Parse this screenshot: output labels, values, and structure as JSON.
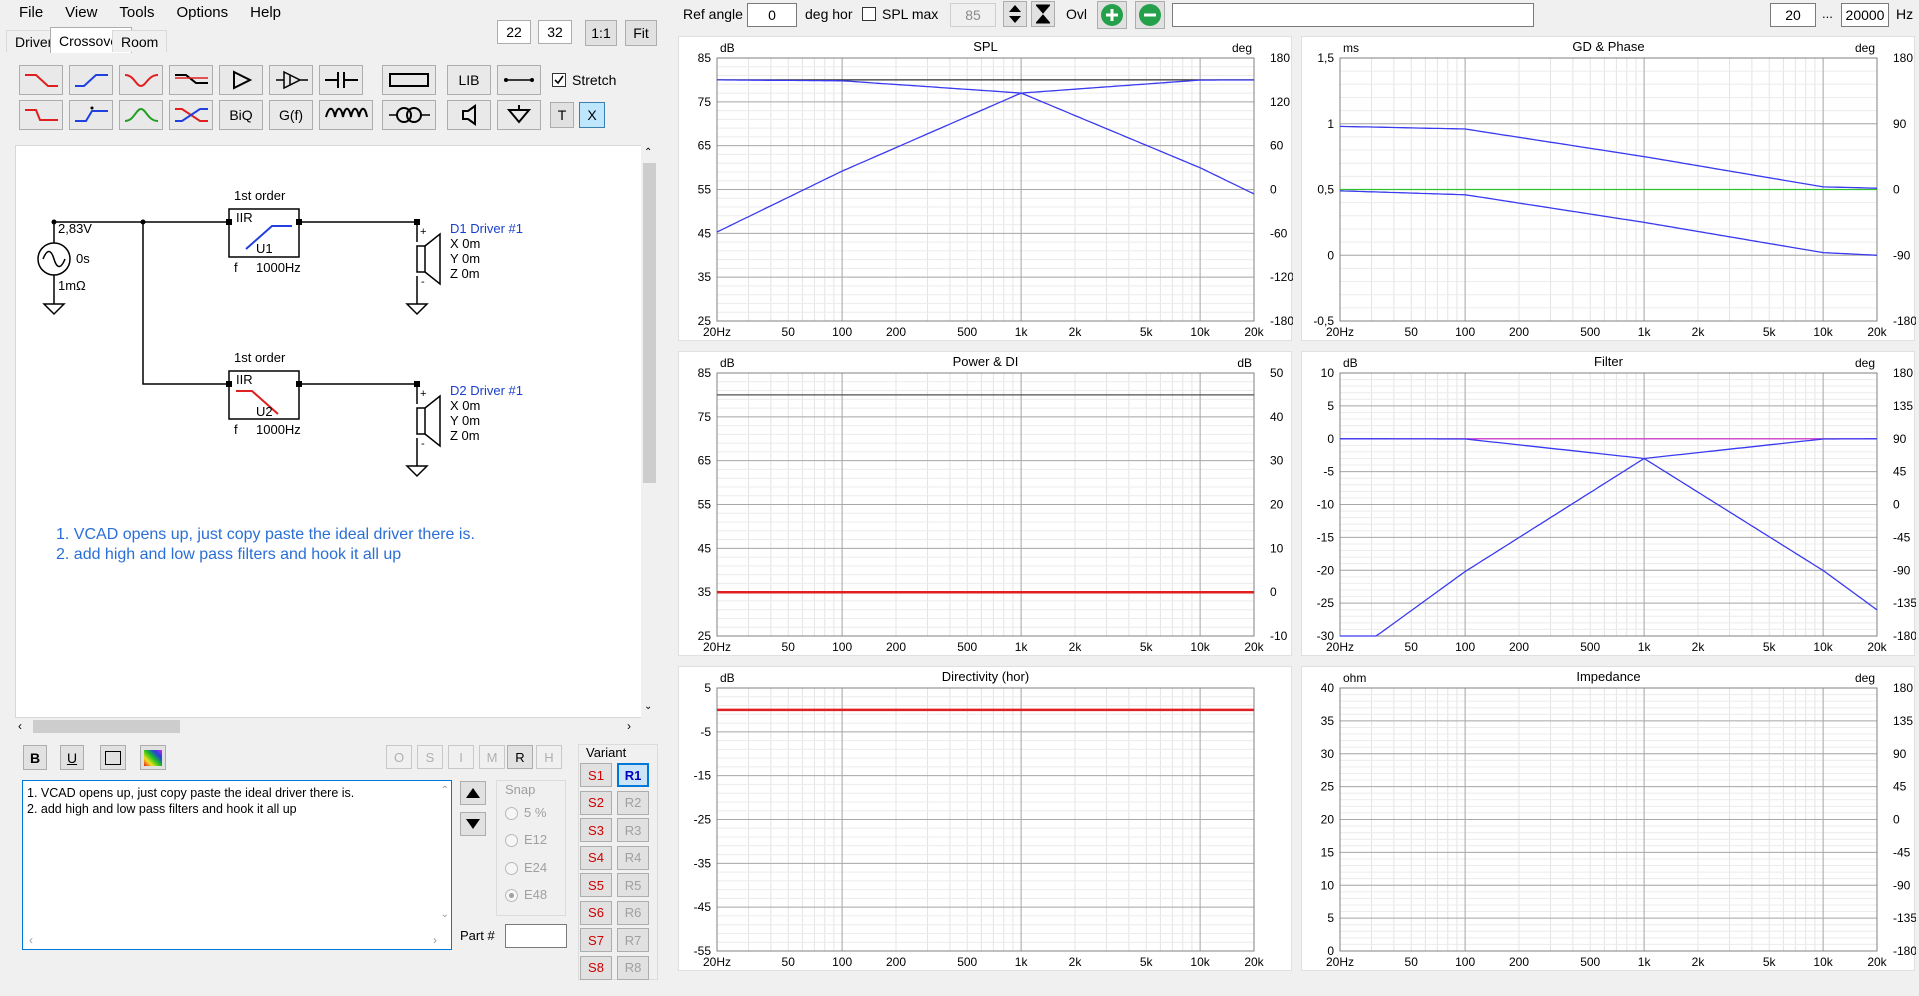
{
  "menu": [
    "File",
    "View",
    "Tools",
    "Options",
    "Help"
  ],
  "tabs": [
    "Drivers",
    "Crossover",
    "Room"
  ],
  "zoom": {
    "a": "22",
    "b": "32",
    "one": "1:1",
    "fit": "Fit"
  },
  "toolbar": {
    "lib": "LIB",
    "biq": "BiQ",
    "gf": "G(f)",
    "t": "T",
    "x": "X",
    "stretch": "Stretch"
  },
  "schematic": {
    "source_v": "2,83V",
    "source_t": "0s",
    "source_r": "1mΩ",
    "f1_title": "1st order",
    "f1_type": "IIR",
    "f1_name": "U1",
    "f1_f": "f",
    "f1_freq": "1000Hz",
    "f2_title": "1st order",
    "f2_type": "IIR",
    "f2_name": "U2",
    "f2_f": "f",
    "f2_freq": "1000Hz",
    "d1_name": "D1 Driver #1",
    "d1_x": "X 0m",
    "d1_y": "Y 0m",
    "d1_z": "Z 0m",
    "d2_name": "D2 Driver #1",
    "d2_x": "X 0m",
    "d2_y": "Y 0m",
    "d2_z": "Z 0m",
    "plus": "+",
    "minus": "-",
    "note1": "1. VCAD opens up, just copy paste the ideal driver there is.",
    "note2": "2. add high and low pass filters and hook it all up"
  },
  "format": {
    "b": "B",
    "u": "U",
    "modes": [
      "O",
      "S",
      "I",
      "M",
      "R",
      "H"
    ]
  },
  "notes_text": "1. VCAD opens up, just copy paste the ideal driver there is.\n2. add high and low pass filters and hook it all up",
  "snap": {
    "label": "Snap",
    "options": [
      "5 %",
      "E12",
      "E24",
      "E48"
    ],
    "selected": "E48"
  },
  "part_label": "Part #",
  "variant": {
    "label": "Variant",
    "s": [
      "S1",
      "S2",
      "S3",
      "S4",
      "S5",
      "S6",
      "S7",
      "S8"
    ],
    "r": [
      "R1",
      "R2",
      "R3",
      "R4",
      "R5",
      "R6",
      "R7",
      "R8"
    ],
    "selected": "R1"
  },
  "topbar": {
    "ref_angle_label": "Ref angle",
    "ref_angle": "0",
    "deg_hor": "deg hor",
    "spl_max_label": "SPL max",
    "spl_max": "85",
    "ovl": "Ovl",
    "fmin": "20",
    "dots": "...",
    "fmax": "20000",
    "hz": "Hz"
  },
  "xticks": [
    "20Hz",
    "50",
    "100",
    "200",
    "500",
    "1k",
    "2k",
    "5k",
    "10k",
    "20k"
  ],
  "charts": [
    {
      "title": "SPL",
      "lunit": "dB",
      "runit": "deg",
      "lticks": [
        "85",
        "75",
        "65",
        "55",
        "45",
        "35",
        "25"
      ],
      "rticks": [
        "180",
        "120",
        "60",
        "0",
        "-60",
        "-120",
        "-180"
      ]
    },
    {
      "title": "GD & Phase",
      "lunit": "ms",
      "runit": "deg",
      "lticks": [
        "1,5",
        "1",
        "0,5",
        "0",
        "-0,5"
      ],
      "rticks": [
        "180",
        "90",
        "0",
        "-90",
        "-180"
      ]
    },
    {
      "title": "Power & DI",
      "lunit": "dB",
      "runit": "dB",
      "lticks": [
        "85",
        "75",
        "65",
        "55",
        "45",
        "35",
        "25"
      ],
      "rticks": [
        "50",
        "40",
        "30",
        "20",
        "10",
        "0",
        "-10"
      ]
    },
    {
      "title": "Filter",
      "lunit": "dB",
      "runit": "deg",
      "lticks": [
        "10",
        "5",
        "0",
        "-5",
        "-10",
        "-15",
        "-20",
        "-25",
        "-30"
      ],
      "rticks": [
        "180",
        "135",
        "90",
        "45",
        "0",
        "-45",
        "-90",
        "-135",
        "-180"
      ]
    },
    {
      "title": "Directivity (hor)",
      "lunit": "dB",
      "runit": "",
      "lticks": [
        "5",
        "-5",
        "-15",
        "-25",
        "-35",
        "-45",
        "-55"
      ],
      "rticks": []
    },
    {
      "title": "Impedance",
      "lunit": "ohm",
      "runit": "deg",
      "lticks": [
        "40",
        "35",
        "30",
        "25",
        "20",
        "15",
        "10",
        "5",
        "0"
      ],
      "rticks": [
        "180",
        "135",
        "90",
        "45",
        "0",
        "-45",
        "-90",
        "-135",
        "-180"
      ]
    }
  ],
  "chart_data": [
    {
      "type": "line",
      "title": "SPL",
      "xlabel": "",
      "ylabel": "dB",
      "xscale": "log",
      "xlim": [
        20,
        20000
      ],
      "ylim": [
        25,
        85
      ],
      "series": [
        {
          "x": [
            20,
            1000,
            20000
          ],
          "y": [
            80,
            80,
            80
          ],
          "color": "#303030"
        },
        {
          "x": [
            20,
            100,
            1000,
            10000,
            20000
          ],
          "y": [
            45.3,
            59.2,
            77,
            79.96,
            79.99
          ],
          "color": "#3a3af0"
        },
        {
          "x": [
            20,
            100,
            1000,
            10000,
            20000
          ],
          "y": [
            80,
            79.8,
            77,
            59.96,
            53.99
          ],
          "color": "#3a3af0"
        }
      ]
    },
    {
      "type": "line",
      "title": "GD & Phase",
      "xlabel": "",
      "ylabel": "ms",
      "xscale": "log",
      "xlim": [
        20,
        20000
      ],
      "ylim": [
        -0.5,
        1.5
      ],
      "series": [
        {
          "x": [
            20,
            20000
          ],
          "y": [
            0.5,
            0.5
          ],
          "color": "#30c030"
        },
        {
          "x": [
            20,
            100,
            1000,
            10000,
            20000
          ],
          "y": [
            0.98,
            0.96,
            0.75,
            0.52,
            0.51
          ],
          "color": "#3a3af0"
        },
        {
          "x": [
            20,
            100,
            1000,
            10000,
            20000
          ],
          "y": [
            0.49,
            0.46,
            0.25,
            0.02,
            0.0
          ],
          "color": "#3a3af0"
        }
      ]
    },
    {
      "type": "line",
      "title": "Power & DI",
      "xlabel": "",
      "ylabel": "dB",
      "xscale": "log",
      "xlim": [
        20,
        20000
      ],
      "ylim": [
        25,
        85
      ],
      "series": [
        {
          "x": [
            20,
            20000
          ],
          "y": [
            80,
            80
          ],
          "color": "#505050"
        },
        {
          "x": [
            20,
            20000
          ],
          "y": [
            35,
            35
          ],
          "color": "#e02020"
        }
      ]
    },
    {
      "type": "line",
      "title": "Filter",
      "xlabel": "",
      "ylabel": "dB",
      "xscale": "log",
      "xlim": [
        20,
        20000
      ],
      "ylim": [
        -30,
        10
      ],
      "series": [
        {
          "x": [
            20,
            20000
          ],
          "y": [
            0,
            0
          ],
          "color": "#d040d0"
        },
        {
          "x": [
            20,
            100,
            1000,
            10000,
            20000
          ],
          "y": [
            -34,
            -20.2,
            -3,
            -0.04,
            -0.01
          ],
          "color": "#3a3af0"
        },
        {
          "x": [
            20,
            100,
            1000,
            10000,
            20000
          ],
          "y": [
            0,
            -0.04,
            -3,
            -20.04,
            -26.02
          ],
          "color": "#3a3af0"
        }
      ]
    },
    {
      "type": "line",
      "title": "Directivity (hor)",
      "xlabel": "",
      "ylabel": "dB",
      "xscale": "log",
      "xlim": [
        20,
        20000
      ],
      "ylim": [
        -55,
        5
      ],
      "series": [
        {
          "x": [
            20,
            20000
          ],
          "y": [
            0,
            0
          ],
          "color": "#e02020"
        }
      ]
    },
    {
      "type": "line",
      "title": "Impedance",
      "xlabel": "",
      "ylabel": "ohm",
      "xscale": "log",
      "xlim": [
        20,
        20000
      ],
      "ylim": [
        0,
        40
      ],
      "series": []
    }
  ],
  "colors": {
    "blue": "#3a3af0",
    "red": "#e02020",
    "green": "#30c030",
    "accent": "#0078d7"
  }
}
